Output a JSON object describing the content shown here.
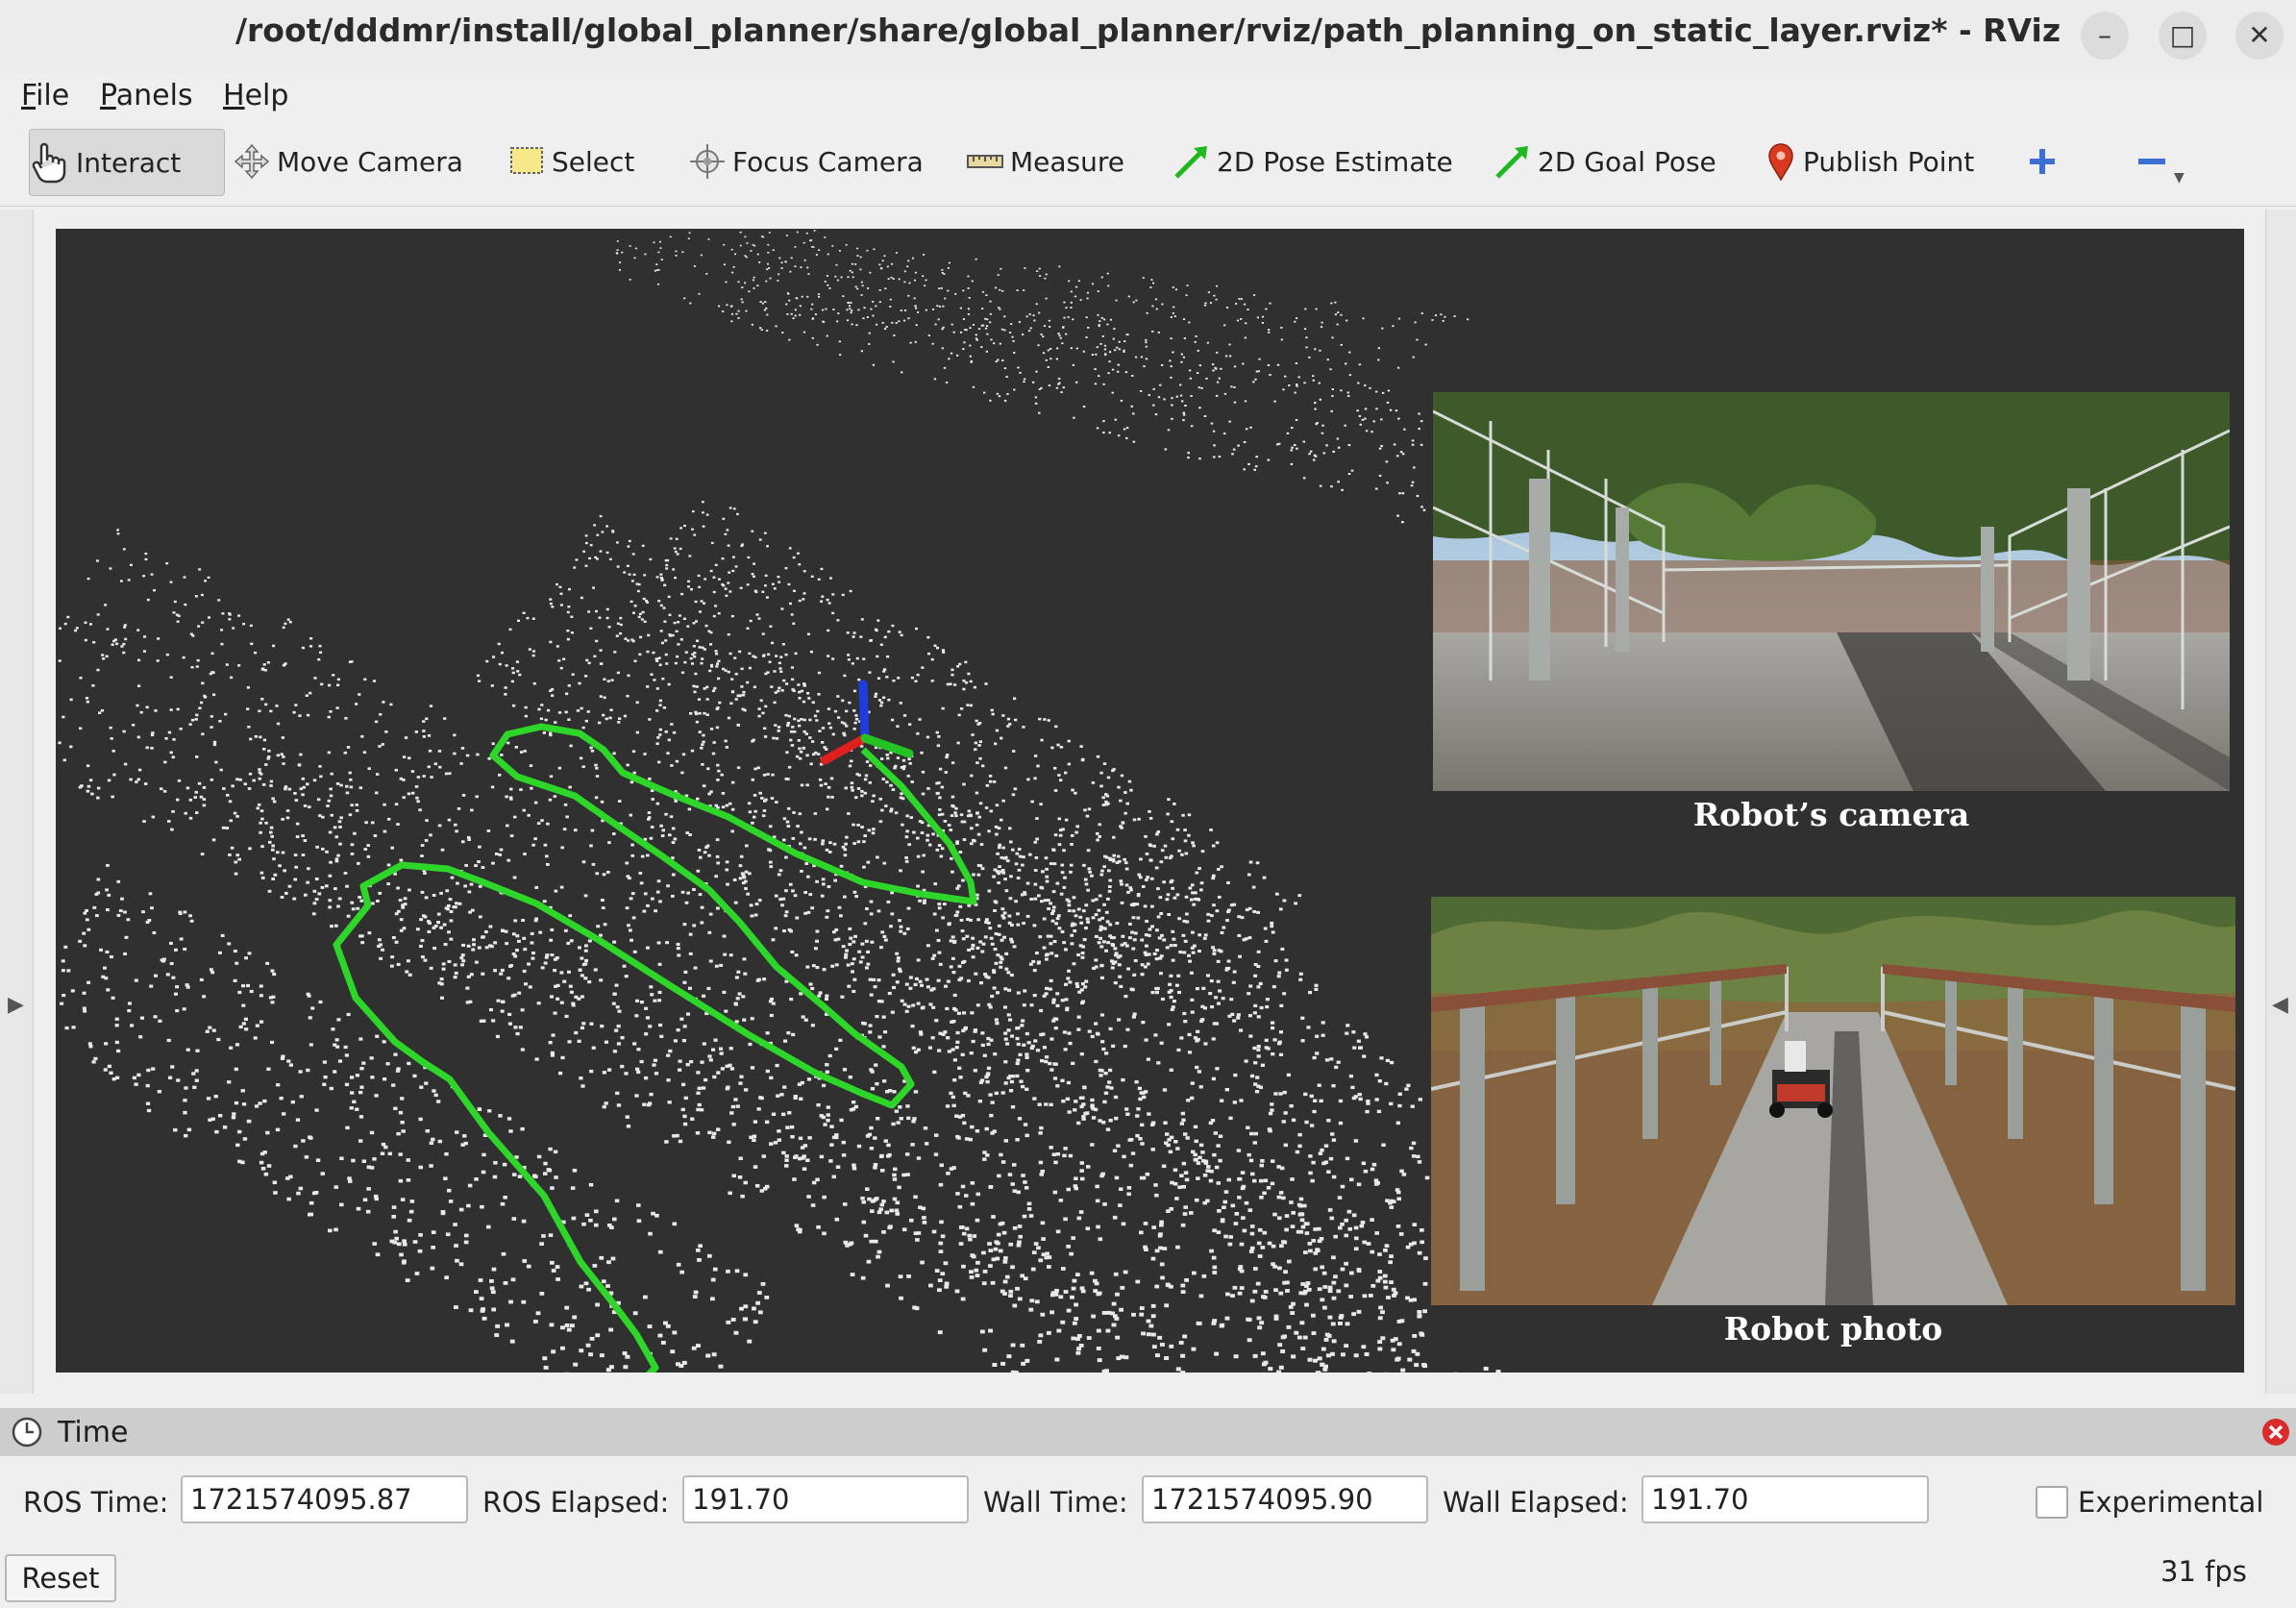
{
  "window": {
    "title": "/root/dddmr/install/global_planner/share/global_planner/rviz/path_planning_on_static_layer.rviz* - RViz",
    "minimize": "–",
    "maximize": "□",
    "close": "✕"
  },
  "menu": {
    "file": {
      "accel": "F",
      "rest": "ile"
    },
    "panels": {
      "accel": "P",
      "rest": "anels"
    },
    "help": {
      "accel": "H",
      "rest": "elp"
    }
  },
  "toolbar": {
    "interact": "Interact",
    "move_camera": "Move Camera",
    "select": "Select",
    "focus_camera": "Focus Camera",
    "measure": "Measure",
    "pose_estimate": "2D Pose Estimate",
    "goal_pose": "2D Goal Pose",
    "publish_point": "Publish Point",
    "add_icon": "plus-icon",
    "remove_icon": "minus-icon"
  },
  "view": {
    "camera_label": "Robot’s camera",
    "photo_label": "Robot photo",
    "path_color": "#2fd62a",
    "background_color": "#303030"
  },
  "time_panel": {
    "title": "Time",
    "ros_time_label": "ROS Time:",
    "ros_time": "1721574095.87",
    "ros_elapsed_label": "ROS Elapsed:",
    "ros_elapsed": "191.70",
    "wall_time_label": "Wall Time:",
    "wall_time": "1721574095.90",
    "wall_elapsed_label": "Wall Elapsed:",
    "wall_elapsed": "191.70",
    "experimental": "Experimental",
    "reset": "Reset",
    "fps": "31 fps"
  }
}
